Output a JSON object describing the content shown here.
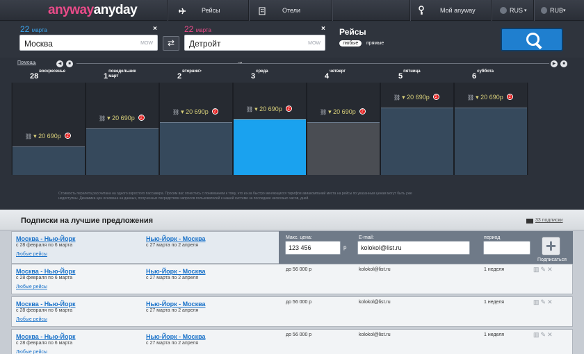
{
  "nav": {
    "logo_part1": "anyway",
    "logo_part2": "anyday",
    "flights": "Рейсы",
    "hotels": "Отели",
    "my_account": "Мой anyway",
    "language": "RUS",
    "currency": "RUB",
    "dropdown_glyph": "▾"
  },
  "search": {
    "from_date_day": "22",
    "from_date_month": "марта",
    "from_city": "Москва",
    "from_code": "MOW",
    "to_date_day": "22",
    "to_date_month": "марта",
    "to_city": "Детройт",
    "to_code": "MOW",
    "clear_glyph": "×",
    "swap_glyph": "⇄",
    "mode_title": "Рейсы",
    "mode_any": "любые",
    "mode_direct": "прямые",
    "accent": "#1f7fcf"
  },
  "calendar": {
    "help": "Помощь",
    "days": [
      {
        "num": "28",
        "name": "воскресенье"
      },
      {
        "num": "1",
        "name": "понедельник март"
      },
      {
        "num": "2",
        "name": "вторник>"
      },
      {
        "num": "3",
        "name": "среда"
      },
      {
        "num": "4",
        "name": "четверг"
      },
      {
        "num": "5",
        "name": "пятница"
      },
      {
        "num": "6",
        "name": "суббота"
      }
    ],
    "price_text": "▾ 20 690р",
    "badge": "2",
    "link_glyph": "⛓",
    "footnote": "Стоимость перелета рассчитана на одного взрослого пассажира. Просим вас отнестись с пониманием к тому, что из-за быстро меняющихся тарифов авиакомпаний места на рейсы по указанным ценам могут быть уже недоступны. Динамика цен основана на данных, полученных посредством запросов пользователей к нашей системе за последние несколько часов, дней."
  },
  "chart_data": {
    "type": "bar",
    "categories": [
      "28",
      "1",
      "2",
      "3",
      "4",
      "5",
      "6"
    ],
    "values": [
      0.31,
      0.5,
      0.57,
      0.6,
      0.57,
      0.73,
      0.73
    ],
    "selected_index": 3,
    "bar_color": "#36495c",
    "selected_color": "#1aa2ef",
    "grey_color": "#4a4d53"
  },
  "subscriptions": {
    "title": "Подписки на лучшие предложения",
    "count": "33 подписки",
    "form": {
      "max_price_label": "Макс. цена:",
      "max_price_value": "123 456",
      "currency_symbol": "р",
      "email_label": "E-mail:",
      "email_value": "kolokol@list.ru",
      "period_label": "период",
      "period_value": "",
      "subscribe_label": "Подписаться",
      "plus_glyph": "+"
    },
    "rows": [
      {
        "route1": "Москва - Нью-Йорк",
        "dates1": "с 28 февраля по 6 марта",
        "route2": "Нью-Йорк - Москва",
        "dates2": "с 27 марта по 2 апреля",
        "any": "Любые рейсы",
        "price": "",
        "email": "",
        "period": ""
      },
      {
        "route1": "Москва - Нью-Йорк",
        "dates1": "с 28 февраля по 6 марта",
        "route2": "Нью-Йорк - Москва",
        "dates2": "с 27 марта по 2 апреля",
        "any": "Любые рейсы",
        "price": "до 56 000 р",
        "email": "kolokol@list.ru",
        "period": "1 неделя"
      },
      {
        "route1": "Москва - Нью-Йорк",
        "dates1": "с 28 февраля по 6 марта",
        "route2": "Нью-Йорк - Москва",
        "dates2": "с 27 марта по 2 апреля",
        "any": "Любые рейсы",
        "price": "до 56 000 р",
        "email": "kolokol@list.ru",
        "period": "1 неделя"
      },
      {
        "route1": "Москва - Нью-Йорк",
        "dates1": "с 28 февраля по 6 марта",
        "route2": "Нью-Йорк - Москва",
        "dates2": "с 27 марта по 2 апреля",
        "any": "Любые рейсы",
        "price": "до 56 000 р",
        "email": "kolokol@list.ru",
        "period": "1 неделя"
      }
    ]
  }
}
